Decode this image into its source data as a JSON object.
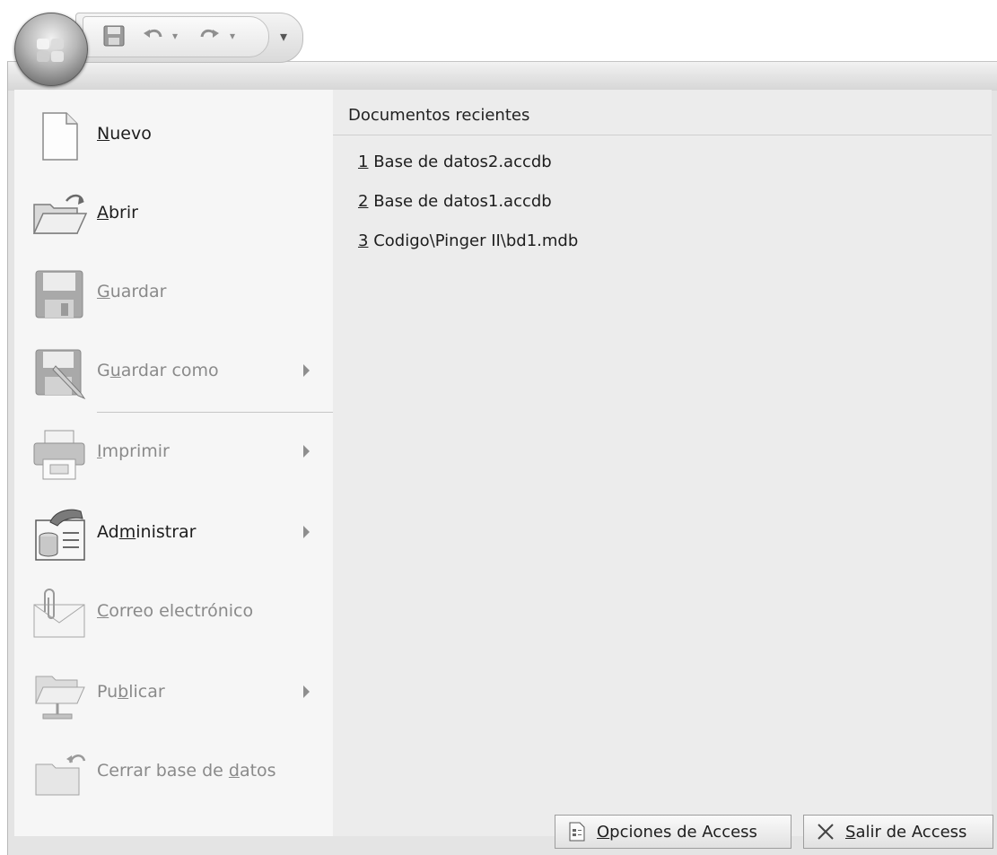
{
  "quick_access": {
    "items": [
      {
        "name": "save-icon",
        "glyph": "💾"
      },
      {
        "name": "undo-icon",
        "glyph": "↶"
      },
      {
        "name": "redo-icon",
        "glyph": "↷"
      }
    ],
    "customize_glyph": "▾"
  },
  "menu": {
    "items": [
      {
        "prefix": "",
        "mnemonic": "N",
        "suffix": "uevo",
        "enabled": true,
        "submenu": false
      },
      {
        "prefix": "",
        "mnemonic": "A",
        "suffix": "brir",
        "enabled": true,
        "submenu": false
      },
      {
        "prefix": "",
        "mnemonic": "G",
        "suffix": "uardar",
        "enabled": false,
        "submenu": false
      },
      {
        "prefix": "G",
        "mnemonic": "u",
        "suffix": "ardar como",
        "enabled": false,
        "submenu": true
      },
      {
        "prefix": "",
        "mnemonic": "I",
        "suffix": "mprimir",
        "enabled": false,
        "submenu": true
      },
      {
        "prefix": "Ad",
        "mnemonic": "m",
        "suffix": "inistrar",
        "enabled": true,
        "submenu": true
      },
      {
        "prefix": "",
        "mnemonic": "C",
        "suffix": "orreo electrónico",
        "enabled": false,
        "submenu": false
      },
      {
        "prefix": "Pu",
        "mnemonic": "b",
        "suffix": "licar",
        "enabled": false,
        "submenu": true
      },
      {
        "prefix": "Cerrar base de ",
        "mnemonic": "d",
        "suffix": "atos",
        "enabled": false,
        "submenu": false
      }
    ]
  },
  "recent": {
    "title": "Documentos recientes",
    "items": [
      {
        "num": "1",
        "name": "Base de datos2.accdb"
      },
      {
        "num": "2",
        "name": "Base de datos1.accdb"
      },
      {
        "num": "3",
        "name": "Codigo\\Pinger II\\bd1.mdb"
      }
    ]
  },
  "footer": {
    "options": {
      "prefix": "",
      "mnemonic": "O",
      "suffix": "pciones de Access"
    },
    "exit": {
      "prefix": "",
      "mnemonic": "S",
      "suffix": "alir de Access"
    }
  }
}
